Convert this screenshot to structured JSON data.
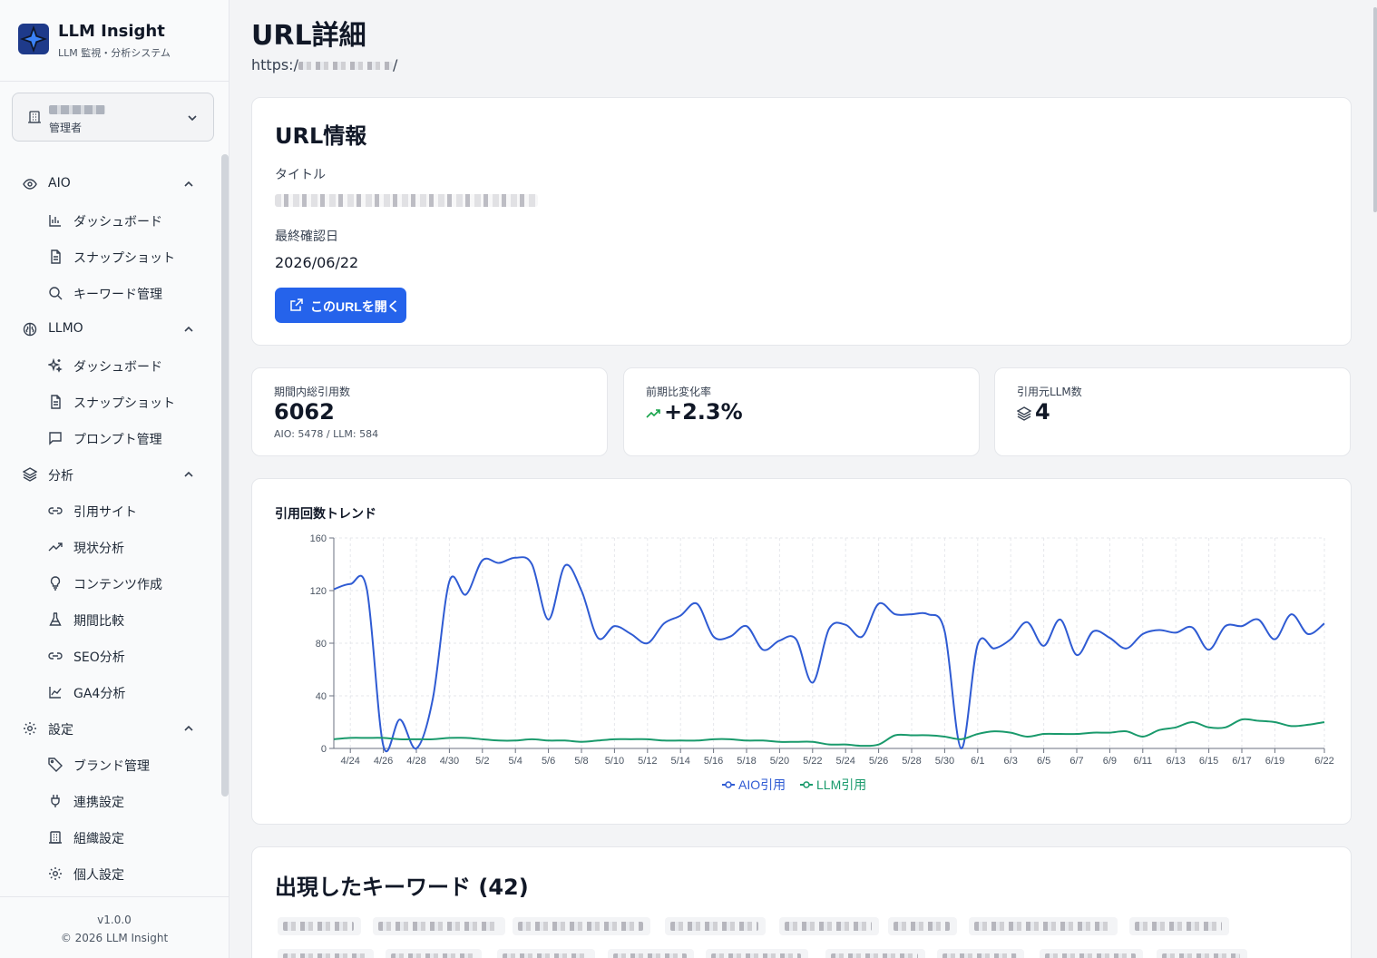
{
  "app": {
    "name": "LLM Insight",
    "subtitle": "LLM 監視・分析システム"
  },
  "org": {
    "role": "管理者"
  },
  "nav": {
    "groups": [
      {
        "label": "AIO",
        "icon": "eye-icon",
        "items": [
          {
            "label": "ダッシュボード",
            "icon": "bar-chart-icon"
          },
          {
            "label": "スナップショット",
            "icon": "document-icon"
          },
          {
            "label": "キーワード管理",
            "icon": "search-icon"
          }
        ]
      },
      {
        "label": "LLMO",
        "icon": "brain-icon",
        "items": [
          {
            "label": "ダッシュボード",
            "icon": "sparkles-icon"
          },
          {
            "label": "スナップショット",
            "icon": "document-icon"
          },
          {
            "label": "プロンプト管理",
            "icon": "message-square-icon"
          }
        ]
      },
      {
        "label": "分析",
        "icon": "layers-icon",
        "items": [
          {
            "label": "引用サイト",
            "icon": "link-icon"
          },
          {
            "label": "現状分析",
            "icon": "trending-up-icon"
          },
          {
            "label": "コンテンツ作成",
            "icon": "lightbulb-icon"
          },
          {
            "label": "期間比較",
            "icon": "flask-icon"
          },
          {
            "label": "SEO分析",
            "icon": "link-icon"
          },
          {
            "label": "GA4分析",
            "icon": "line-chart-icon"
          }
        ]
      },
      {
        "label": "設定",
        "icon": "gear-icon",
        "items": [
          {
            "label": "ブランド管理",
            "icon": "tag-icon"
          },
          {
            "label": "連携設定",
            "icon": "plug-icon"
          },
          {
            "label": "組織設定",
            "icon": "building-icon"
          },
          {
            "label": "個人設定",
            "icon": "gear-icon"
          }
        ]
      }
    ]
  },
  "footer": {
    "version": "v1.0.0",
    "copyright": "© 2026 LLM Insight"
  },
  "page": {
    "title": "URL詳細",
    "url_prefix": "https:/",
    "url_suffix": "/"
  },
  "url_info": {
    "title": "URL情報",
    "title_label": "タイトル",
    "last_checked_label": "最終確認日",
    "last_checked": "2026/06/22",
    "open_button": "このURLを開く"
  },
  "stats": {
    "total": {
      "label": "期間内総引用数",
      "value": "6062",
      "sub": "AIO: 5478 / LLM: 584"
    },
    "change": {
      "label": "前期比変化率",
      "value": "+2.3%",
      "icon": "trending-up-icon"
    },
    "llm_count": {
      "label": "引用元LLM数",
      "value": "4",
      "icon": "layers-icon"
    }
  },
  "colors": {
    "primary": "#2563eb",
    "aio": "#2f5bd3",
    "llm": "#1a9a6c"
  },
  "chart_data": {
    "type": "line",
    "title": "引用回数トレンド",
    "ylim": [
      0,
      160
    ],
    "yticks": [
      0,
      40,
      80,
      120,
      160
    ],
    "grid": true,
    "legend": "bottom-center",
    "x": [
      "4/23",
      "4/24",
      "4/25",
      "4/26",
      "4/27",
      "4/28",
      "4/29",
      "4/30",
      "5/1",
      "5/2",
      "5/3",
      "5/4",
      "5/5",
      "5/6",
      "5/7",
      "5/8",
      "5/9",
      "5/10",
      "5/11",
      "5/12",
      "5/13",
      "5/14",
      "5/15",
      "5/16",
      "5/17",
      "5/18",
      "5/19",
      "5/20",
      "5/21",
      "5/22",
      "5/23",
      "5/24",
      "5/25",
      "5/26",
      "5/27",
      "5/28",
      "5/29",
      "5/30",
      "5/31",
      "6/1",
      "6/2",
      "6/3",
      "6/4",
      "6/5",
      "6/6",
      "6/7",
      "6/8",
      "6/9",
      "6/10",
      "6/11",
      "6/12",
      "6/13",
      "6/14",
      "6/15",
      "6/16",
      "6/17",
      "6/18",
      "6/19",
      "6/20",
      "6/21",
      "6/22"
    ],
    "xtick_labels": [
      "4/24",
      "4/26",
      "4/28",
      "4/30",
      "5/2",
      "5/4",
      "5/6",
      "5/8",
      "5/10",
      "5/12",
      "5/14",
      "5/16",
      "5/18",
      "5/20",
      "5/22",
      "5/24",
      "5/26",
      "5/28",
      "5/30",
      "6/1",
      "6/3",
      "6/5",
      "6/7",
      "6/9",
      "6/11",
      "6/13",
      "6/15",
      "6/17",
      "6/19",
      "6/22"
    ],
    "series": [
      {
        "name": "AIO引用",
        "values": [
          121,
          125,
          121,
          2,
          22,
          0,
          38,
          127,
          117,
          143,
          141,
          145,
          140,
          98,
          139,
          120,
          84,
          93,
          87,
          80,
          95,
          101,
          110,
          85,
          85,
          93,
          75,
          82,
          83,
          50,
          91,
          94,
          85,
          110,
          102,
          102,
          102,
          89,
          0,
          79,
          76,
          83,
          96,
          78,
          98,
          71,
          89,
          84,
          76,
          87,
          90,
          88,
          92,
          75,
          93,
          93,
          98,
          83,
          102,
          87,
          95
        ]
      },
      {
        "name": "LLM引用",
        "values": [
          7,
          8,
          8,
          8,
          7,
          7,
          7,
          8,
          8,
          7,
          6,
          6,
          7,
          6,
          6,
          5,
          6,
          7,
          7,
          7,
          6,
          6,
          6,
          7,
          7,
          6,
          6,
          5,
          5,
          5,
          3,
          3,
          2,
          3,
          10,
          10,
          10,
          9,
          7,
          11,
          13,
          12,
          9,
          11,
          11,
          11,
          12,
          12,
          13,
          9,
          14,
          16,
          20,
          16,
          16,
          22,
          21,
          20,
          17,
          18,
          20
        ]
      }
    ]
  },
  "keywords": {
    "title": "出現したキーワード (42)"
  }
}
